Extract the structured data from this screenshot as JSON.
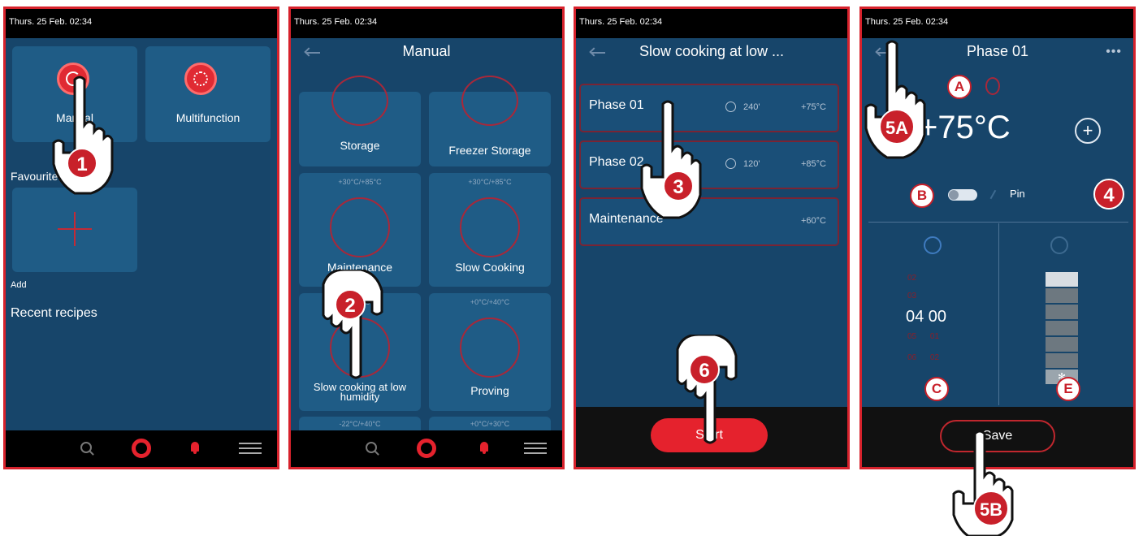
{
  "status_time": "Thurs. 25 Feb. 02:34",
  "screen1": {
    "tiles": [
      {
        "label": "Manual"
      },
      {
        "label": "Multifunction"
      }
    ],
    "favourites_heading": "Favourite recipes",
    "add_label": "Add",
    "recent_heading": "Recent recipes"
  },
  "screen2": {
    "title": "Manual",
    "tiles": [
      {
        "label": "Storage",
        "range": ""
      },
      {
        "label": "Freezer Storage",
        "range": ""
      },
      {
        "label": "Maintenance",
        "range": "+30°C/+85°C"
      },
      {
        "label": "Slow Cooking",
        "range": "+30°C/+85°C"
      },
      {
        "label": "Slow cooking at low humidity",
        "range": "+30°C"
      },
      {
        "label": "Proving",
        "range": "+0°C/+40°C"
      },
      {
        "label": "",
        "range": "-22°C/+40°C"
      },
      {
        "label": "",
        "range": "+0°C/+30°C"
      }
    ]
  },
  "screen3": {
    "title": "Slow cooking at low ...",
    "phases": [
      {
        "name": "Phase 01",
        "time": "240'",
        "temp": "+75°C"
      },
      {
        "name": "Phase 02",
        "time": "120'",
        "temp": "+85°C"
      },
      {
        "name": "Maintenance",
        "time": "",
        "temp": "+60°C"
      }
    ],
    "start_label": "Start"
  },
  "screen4": {
    "title": "Phase 01",
    "temperature": "+75°C",
    "pin_label": "Pin",
    "timer": {
      "above": [
        "02",
        "03"
      ],
      "current": "04 00",
      "below": [
        "05 01",
        "06 02"
      ]
    },
    "fan_level": 0.2,
    "save_label": "Save"
  },
  "steps": [
    "1",
    "2",
    "3",
    "4",
    "5A",
    "5B",
    "6"
  ],
  "letters": [
    "A",
    "B",
    "C",
    "E"
  ],
  "colors": {
    "screen_bg": "#17456a",
    "tile": "#1f5c86",
    "accent": "#e5222d",
    "frame": "#d7222c"
  }
}
